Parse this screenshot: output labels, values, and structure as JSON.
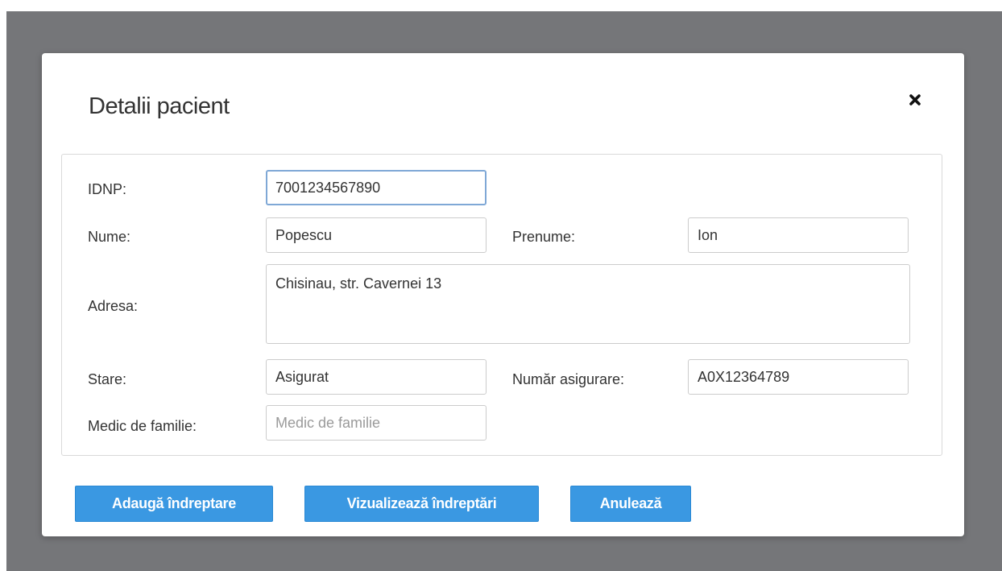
{
  "dialog": {
    "title": "Detalii pacient"
  },
  "form": {
    "idnp": {
      "label": "IDNP:",
      "value": "7001234567890"
    },
    "nume": {
      "label": "Nume:",
      "value": "Popescu"
    },
    "prenume": {
      "label": "Prenume:",
      "value": "Ion"
    },
    "adresa": {
      "label": "Adresa:",
      "value": "Chisinau, str. Cavernei 13"
    },
    "stare": {
      "label": "Stare:",
      "value": "Asigurat"
    },
    "numar_asigurare": {
      "label": "Număr asigurare:",
      "value": "A0X12364789"
    },
    "medic_familie": {
      "label": "Medic de familie:",
      "value": "",
      "placeholder": "Medic de familie"
    }
  },
  "buttons": {
    "add_referral": "Adaugă îndreptare",
    "view_referrals": "Vizualizează îndreptări",
    "cancel": "Anulează"
  },
  "icons": {
    "close": "close-icon"
  },
  "colors": {
    "backdrop": "#757679",
    "primary_button": "#3a98e2",
    "focus_border": "#7fa8d6"
  }
}
